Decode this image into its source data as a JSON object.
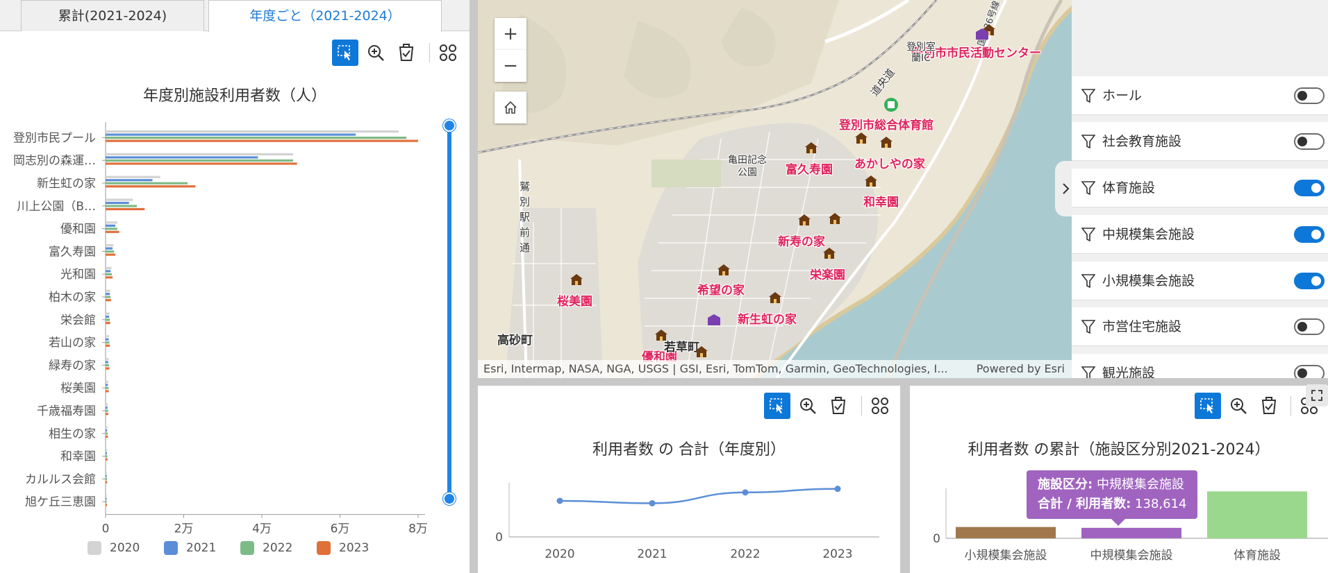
{
  "tabs": [
    {
      "label": "累計(2021-2024)",
      "active": false
    },
    {
      "label": "年度ごと（2021-2024）",
      "active": true
    }
  ],
  "toolbar": {
    "select_icon": "selection-icon",
    "zoom_icon": "zoom-icon",
    "clear_icon": "clear-selection-icon",
    "grid_icon": "grid-icon"
  },
  "left_chart": {
    "title": "年度別施設利用者数（人）",
    "x_ticks": [
      "0",
      "2万",
      "4万",
      "6万",
      "8万"
    ],
    "legend": [
      "2020",
      "2021",
      "2022",
      "2023"
    ],
    "chart_data": {
      "type": "bar",
      "orientation": "horizontal",
      "title": "年度別施設利用者数（人）",
      "xlim": [
        0,
        80000
      ],
      "labels": [
        "登別市民プール",
        "岡志別の森運動公園",
        "新生虹の家",
        "川上公園（Bゾーン）",
        "優和園",
        "富久寿園",
        "光和園",
        "柏木の家",
        "栄会館",
        "若山の家",
        "緑寿の家",
        "桜美園",
        "千歳福寿園",
        "相生の家",
        "和幸園",
        "カルルス会館",
        "旭ケ丘三恵園"
      ],
      "series": [
        {
          "name": "2020",
          "color": "#d3d3d3",
          "values": [
            75000,
            48000,
            14000,
            7000,
            3000,
            2000,
            1500,
            1200,
            1000,
            900,
            800,
            700,
            600,
            500,
            400,
            300,
            300
          ]
        },
        {
          "name": "2021",
          "color": "#5b8ed6",
          "values": [
            64000,
            39000,
            12000,
            6000,
            2500,
            1800,
            1300,
            1100,
            900,
            800,
            700,
            600,
            500,
            400,
            350,
            300,
            250
          ]
        },
        {
          "name": "2022",
          "color": "#7dbb86",
          "values": [
            77000,
            48000,
            21000,
            8000,
            3000,
            2200,
            1600,
            1300,
            1100,
            1000,
            900,
            750,
            650,
            550,
            450,
            350,
            300
          ]
        },
        {
          "name": "2023",
          "color": "#e0703a",
          "values": [
            80000,
            49000,
            23000,
            10000,
            3500,
            2500,
            1800,
            1400,
            1200,
            1100,
            1000,
            800,
            700,
            600,
            500,
            400,
            350
          ]
        }
      ]
    }
  },
  "map": {
    "zoom_in": "+",
    "zoom_out": "−",
    "home_icon": "home-icon",
    "attribution": "Esri, Intermap, NASA, NGA, USGS | GSI, Esri, TomTom, Garmin, GeoTechnologies, I...",
    "powered_by": "Powered by Esri",
    "labels": {
      "center": "登別市市民活動センター",
      "gym": "登別市総合体育館",
      "kameda": "亀田記念公園",
      "fukujuen": "富久寿園",
      "akashiya": "あかしやの家",
      "wakoen": "和幸園",
      "shinju": "新寿の家",
      "eirakuen": "栄楽園",
      "kibou": "希望の家",
      "ouhien": "桜美園",
      "shinsei": "新生虹の家",
      "yuwaen": "優和園",
      "takasago": "高砂町",
      "wakakusa": "若草町",
      "road_ekimae": "鷲別駅前通",
      "road_route": "道央道",
      "ic": "登別室蘭IC",
      "route36": "国道36号線"
    }
  },
  "filters": [
    {
      "label": "ホール",
      "on": false
    },
    {
      "label": "社会教育施設",
      "on": false
    },
    {
      "label": "体育施設",
      "on": true
    },
    {
      "label": "中規模集会施設",
      "on": true
    },
    {
      "label": "小規模集会施設",
      "on": true
    },
    {
      "label": "市営住宅施設",
      "on": false
    },
    {
      "label": "観光施設",
      "on": false
    }
  ],
  "line_chart": {
    "title": "利用者数 の 合計（年度別）",
    "y_tick": "0",
    "x_ticks": [
      "2020",
      "2021",
      "2022",
      "2023"
    ],
    "chart_data": {
      "type": "line",
      "title": "利用者数 の 合計（年度別）",
      "x": [
        "2020",
        "2021",
        "2022",
        "2023"
      ],
      "values": [
        300000,
        280000,
        370000,
        400000
      ],
      "ylim": [
        0,
        450000
      ]
    }
  },
  "bar_chart": {
    "title": "利用者数 の累計（施設区分別2021-2024）",
    "y_tick": "0",
    "categories": [
      "小規模集会施設",
      "中規模集会施設",
      "体育施設"
    ],
    "tooltip": {
      "k1": "施設区分:",
      "v1": "中規模集会施設",
      "k2": "合計 / 利用者数:",
      "v2": "138,614"
    },
    "chart_data": {
      "type": "bar",
      "title": "利用者数 の累計（施設区分別2021-2024）",
      "categories": [
        "小規模集会施設",
        "中規模集会施設",
        "体育施設"
      ],
      "values": [
        150000,
        138614,
        620000
      ],
      "colors": [
        "#a0784c",
        "#a064c0",
        "#9ad88e"
      ],
      "ylim": [
        0,
        660000
      ]
    }
  }
}
